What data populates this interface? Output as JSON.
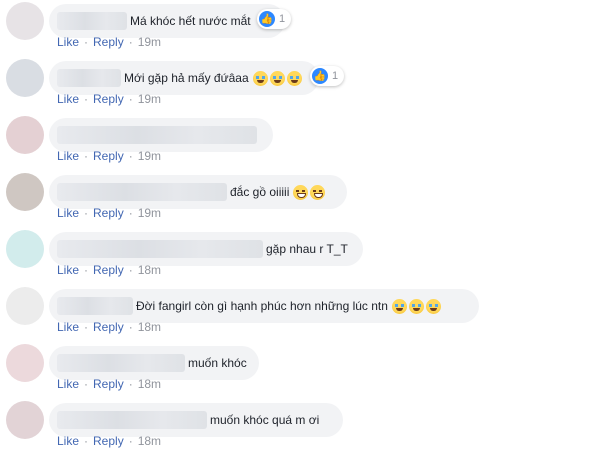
{
  "actions": {
    "like": "Like",
    "reply": "Reply",
    "separator": "·"
  },
  "comments": [
    {
      "text": "Má khóc hết nước mắt",
      "emoji": [],
      "reaction_count": "1",
      "time": "19m"
    },
    {
      "text": "Mới gặp hả mấy đứâaa",
      "emoji": [
        "crying-face-icon",
        "crying-face-icon",
        "crying-face-icon"
      ],
      "reaction_count": "1",
      "time": "19m"
    },
    {
      "text": "",
      "emoji": [],
      "reaction_count": "",
      "time": "19m"
    },
    {
      "text": "đắc gồ oiiiii",
      "emoji": [
        "laughing-face-icon",
        "laughing-face-icon"
      ],
      "reaction_count": "",
      "time": "19m"
    },
    {
      "text": "gặp nhau r T_T",
      "emoji": [],
      "reaction_count": "",
      "time": "18m"
    },
    {
      "text": "Đời fangirl còn gì hạnh phúc hơn những lúc ntn",
      "emoji": [
        "crying-face-icon",
        "crying-face-icon",
        "crying-face-icon"
      ],
      "reaction_count": "",
      "time": "18m"
    },
    {
      "text": "muốn khóc",
      "emoji": [],
      "reaction_count": "",
      "time": "18m"
    },
    {
      "text": "muốn khóc quá m ơi",
      "emoji": [],
      "reaction_count": "",
      "time": "18m"
    }
  ],
  "colors": {
    "link": "#4267b2",
    "bubble": "#f2f3f5",
    "like_blue": "#2d88ff",
    "meta_gray": "#90949c"
  }
}
